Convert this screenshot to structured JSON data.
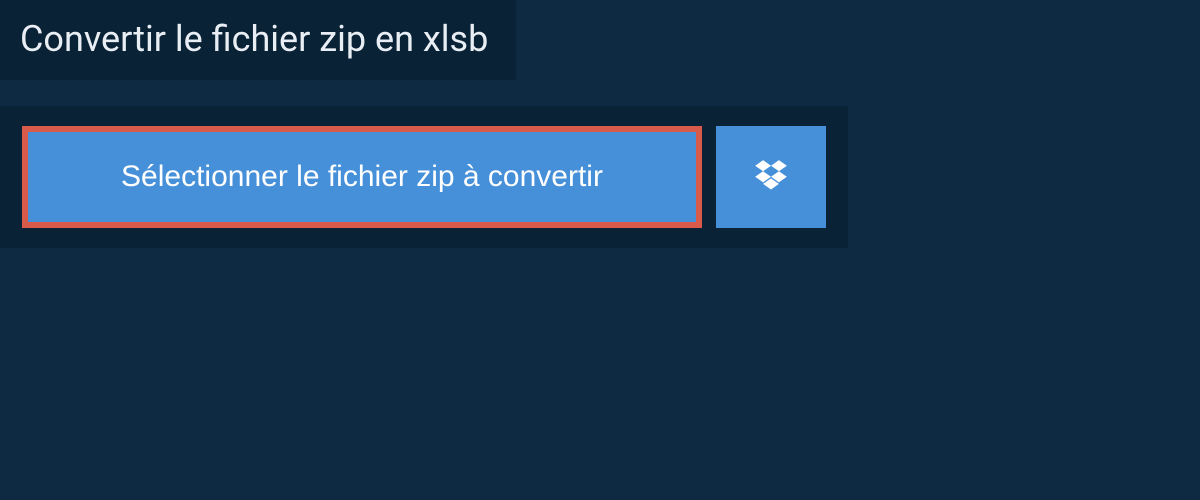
{
  "title": "Convertir le fichier zip en xlsb",
  "selectButton": "Sélectionner le fichier zip à convertir",
  "colors": {
    "background": "#0d2a42",
    "panelBackground": "#0a2236",
    "buttonBackground": "#4690d9",
    "highlightBorder": "#d85a4a",
    "textLight": "#e8eef4"
  }
}
